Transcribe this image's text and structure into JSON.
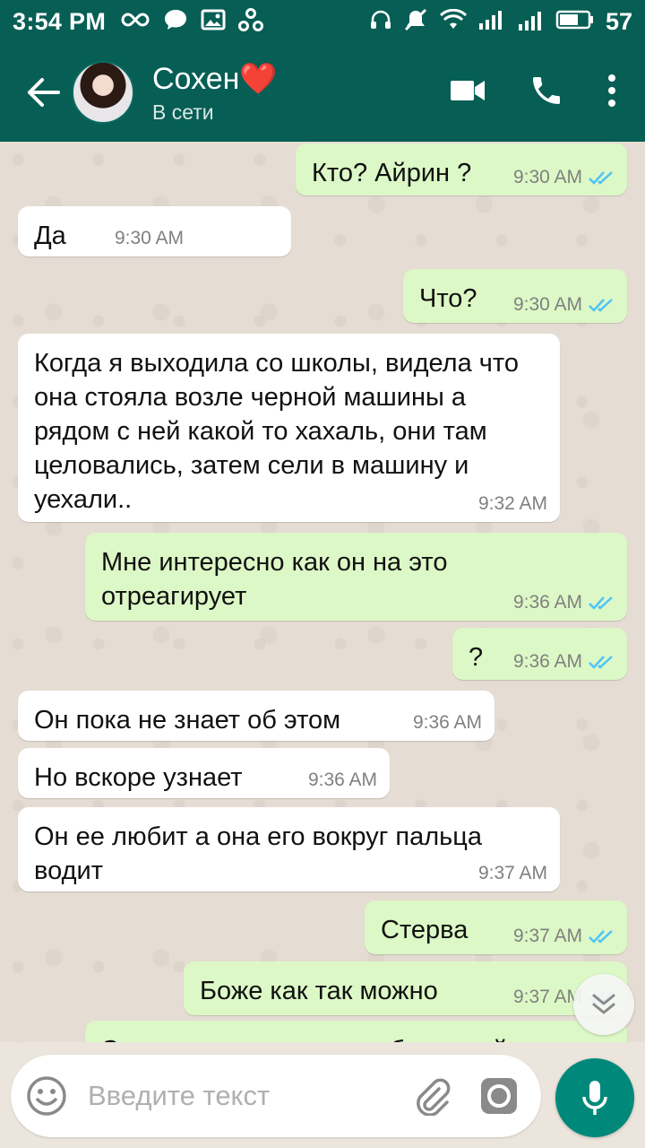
{
  "status_bar": {
    "time": "3:54 PM",
    "battery": "57",
    "icons": [
      "infinity-icon",
      "chat-icon",
      "image-icon",
      "share-icon",
      "headset-icon",
      "mute-icon",
      "wifi-icon",
      "signal-icon",
      "signal-4g-icon",
      "battery-icon"
    ]
  },
  "header": {
    "contact_name": "Сохен❤️",
    "contact_status": "В сети"
  },
  "messages": [
    {
      "dir": "out",
      "text": "Кто? Айрин ?",
      "time": "9:30 AM",
      "read": true
    },
    {
      "dir": "in",
      "text": "Да",
      "time": "9:30 AM"
    },
    {
      "dir": "out",
      "text": "Что?",
      "time": "9:30 AM",
      "read": true
    },
    {
      "dir": "in",
      "text": "Когда я выходила со школы, видела что она стояла возле черной машины а рядом с ней какой то хахаль, они там целовались, затем сели в машину и уехали..",
      "time": "9:32 AM"
    },
    {
      "dir": "out",
      "text": "Мне интересно как он на это отреагирует",
      "time": "9:36 AM",
      "read": true
    },
    {
      "dir": "out",
      "text": "?",
      "time": "9:36 AM",
      "read": true
    },
    {
      "dir": "in",
      "text": "Он пока не знает об этом",
      "time": "9:36 AM"
    },
    {
      "dir": "in",
      "text": "Но вскоре узнает",
      "time": "9:36 AM"
    },
    {
      "dir": "in",
      "text": "Он ее любит а она его вокруг пальца водит",
      "time": "9:37 AM"
    },
    {
      "dir": "out",
      "text": "Стерва",
      "time": "9:37 AM",
      "read": true
    },
    {
      "dir": "out",
      "text": "Боже как так можно",
      "time": "9:37 AM",
      "read": true
    },
    {
      "dir": "out",
      "text": "Это надо на столько любить свой",
      "time": "",
      "read": false
    }
  ],
  "input": {
    "placeholder": "Введите текст"
  },
  "colors": {
    "header": "#075e54",
    "outgoing_bubble": "#dcf8c6",
    "incoming_bubble": "#ffffff",
    "read_ticks": "#4fc3f7",
    "mic_button": "#00897b"
  }
}
